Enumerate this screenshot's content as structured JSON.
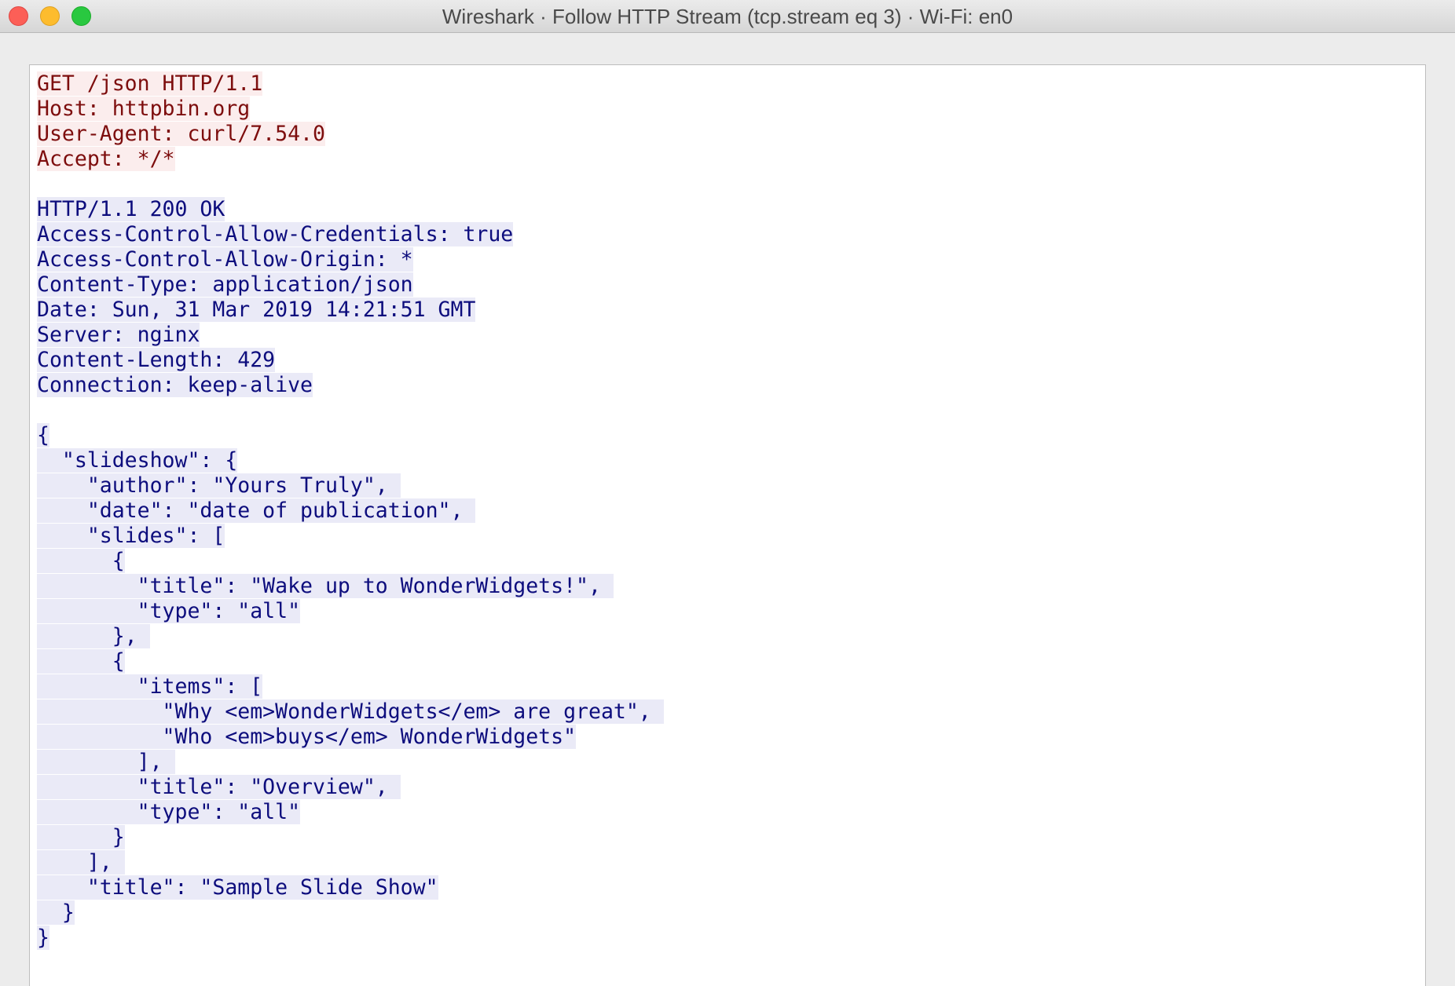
{
  "window": {
    "title": "Wireshark · Follow HTTP Stream (tcp.stream eq 3) · Wi-Fi: en0"
  },
  "colors": {
    "client_text": "#7d0d0d",
    "client_background": "#fbeded",
    "server_text": "#0d0d7d",
    "server_background": "#eaeaf7"
  },
  "stream": {
    "lines": [
      {
        "side": "client",
        "text": "GET /json HTTP/1.1"
      },
      {
        "side": "client",
        "text": "Host: httpbin.org"
      },
      {
        "side": "client",
        "text": "User-Agent: curl/7.54.0"
      },
      {
        "side": "client",
        "text": "Accept: */*"
      },
      {
        "side": "blank",
        "text": ""
      },
      {
        "side": "server",
        "text": "HTTP/1.1 200 OK"
      },
      {
        "side": "server",
        "text": "Access-Control-Allow-Credentials: true"
      },
      {
        "side": "server",
        "text": "Access-Control-Allow-Origin: *"
      },
      {
        "side": "server",
        "text": "Content-Type: application/json"
      },
      {
        "side": "server",
        "text": "Date: Sun, 31 Mar 2019 14:21:51 GMT"
      },
      {
        "side": "server",
        "text": "Server: nginx"
      },
      {
        "side": "server",
        "text": "Content-Length: 429"
      },
      {
        "side": "server",
        "text": "Connection: keep-alive"
      },
      {
        "side": "blank",
        "text": ""
      },
      {
        "side": "server",
        "text": "{"
      },
      {
        "side": "server",
        "text": "  \"slideshow\": {"
      },
      {
        "side": "server",
        "text": "    \"author\": \"Yours Truly\", "
      },
      {
        "side": "server",
        "text": "    \"date\": \"date of publication\", "
      },
      {
        "side": "server",
        "text": "    \"slides\": ["
      },
      {
        "side": "server",
        "text": "      {"
      },
      {
        "side": "server",
        "text": "        \"title\": \"Wake up to WonderWidgets!\", "
      },
      {
        "side": "server",
        "text": "        \"type\": \"all\""
      },
      {
        "side": "server",
        "text": "      }, "
      },
      {
        "side": "server",
        "text": "      {"
      },
      {
        "side": "server",
        "text": "        \"items\": ["
      },
      {
        "side": "server",
        "text": "          \"Why <em>WonderWidgets</em> are great\", "
      },
      {
        "side": "server",
        "text": "          \"Who <em>buys</em> WonderWidgets\""
      },
      {
        "side": "server",
        "text": "        ], "
      },
      {
        "side": "server",
        "text": "        \"title\": \"Overview\", "
      },
      {
        "side": "server",
        "text": "        \"type\": \"all\""
      },
      {
        "side": "server",
        "text": "      }"
      },
      {
        "side": "server",
        "text": "    ], "
      },
      {
        "side": "server",
        "text": "    \"title\": \"Sample Slide Show\""
      },
      {
        "side": "server",
        "text": "  }"
      },
      {
        "side": "server",
        "text": "}"
      }
    ]
  }
}
